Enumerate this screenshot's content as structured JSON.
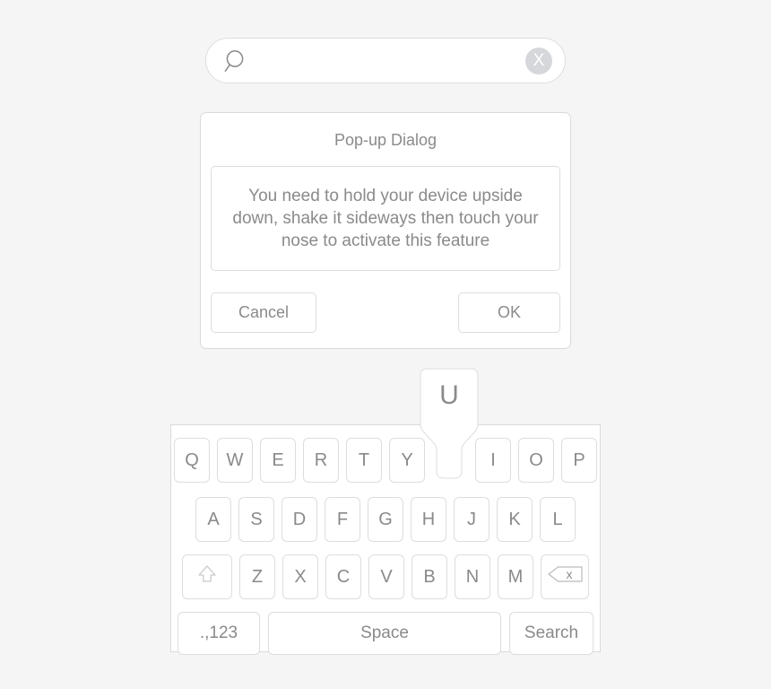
{
  "search": {
    "icon": "search-icon",
    "value": "",
    "placeholder": "",
    "clear_label": "X",
    "clear_icon": "clear-circle-x-icon"
  },
  "dialog": {
    "title": "Pop-up Dialog",
    "message": "You need to hold your device upside down, shake it sideways then touch your nose to activate this feature",
    "cancel_label": "Cancel",
    "ok_label": "OK"
  },
  "keyboard": {
    "popup_key": "U",
    "row1": [
      "Q",
      "W",
      "E",
      "R",
      "T",
      "Y",
      "U",
      "I",
      "O",
      "P"
    ],
    "row2": [
      "A",
      "S",
      "D",
      "F",
      "G",
      "H",
      "J",
      "K",
      "L"
    ],
    "row3_letters": [
      "Z",
      "X",
      "C",
      "V",
      "B",
      "N",
      "M"
    ],
    "shift_icon": "shift-arrow-icon",
    "backspace_icon": "backspace-delete-icon",
    "backspace_label": "x",
    "numbers_label": ".,123",
    "space_label": "Space",
    "search_label": "Search"
  },
  "colors": {
    "background": "#f5f5f5",
    "surface": "#ffffff",
    "border": "#dcdde1",
    "text": "#8a8a8a",
    "clear_button": "#d6d7da"
  }
}
